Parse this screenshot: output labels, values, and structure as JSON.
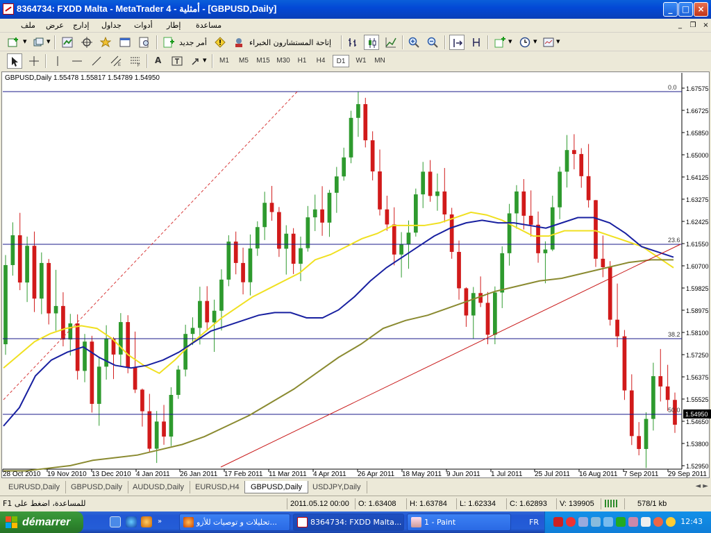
{
  "window": {
    "title": "8364734: FXDD Malta - MetaTrader 4 - أمثلية - [GBPUSD,Daily]",
    "controls": {
      "minimize": "_",
      "maximize": "□",
      "close": "×"
    }
  },
  "menu": {
    "items": [
      "ملف",
      "عرض",
      "إدارج",
      "جداول",
      "أدوات",
      "إطار",
      "مساعدة"
    ],
    "mdi": {
      "minimize": "_",
      "restore": "❐",
      "close": "×"
    }
  },
  "toolbar1": {
    "new_order": "أمر جديد",
    "experts": "إتاحة المستشارون الخبراء"
  },
  "toolbar2": {
    "periods": [
      "M1",
      "M5",
      "M15",
      "M30",
      "H1",
      "H4",
      "D1",
      "W1",
      "MN"
    ],
    "active_period": "D1",
    "text_tool": "A"
  },
  "chart": {
    "info": "GBPUSD,Daily  1.55478 1.55817 1.54789 1.54950"
  },
  "chart_data": {
    "type": "candlestick",
    "symbol": "GBPUSD",
    "timeframe": "Daily",
    "ohlc_last": {
      "open": 1.55478,
      "high": 1.55817,
      "low": 1.54789,
      "close": 1.5495
    },
    "current_price": "1.54950",
    "ylim": [
      1.5295,
      1.67575
    ],
    "y_ticks": [
      "1.67575",
      "1.66725",
      "1.65850",
      "1.65000",
      "1.64125",
      "1.63275",
      "1.62425",
      "1.61550",
      "1.60700",
      "1.59825",
      "1.58975",
      "1.58100",
      "1.57250",
      "1.56375",
      "1.55525",
      "1.54650",
      "1.53800",
      "1.52950"
    ],
    "x_ticks": [
      "28 Oct 2010",
      "19 Nov 2010",
      "13 Dec 2010",
      "4 Jan 2011",
      "26 Jan 2011",
      "17 Feb 2011",
      "11 Mar 2011",
      "4 Apr 2011",
      "26 Apr 2011",
      "18 May 2011",
      "9 Jun 2011",
      "1 Jul 2011",
      "25 Jul 2011",
      "16 Aug 2011",
      "7 Sep 2011",
      "29 Sep 2011"
    ],
    "fibonacci": [
      {
        "label": "0.0",
        "price": 1.67575
      },
      {
        "label": "23.6",
        "price": 1.6155
      },
      {
        "label": "38.2",
        "price": 1.5788
      },
      {
        "label": "50.0",
        "price": 1.5484
      }
    ],
    "moving_averages": [
      {
        "color": "#f0e020",
        "values": [
          1.571,
          1.576,
          1.581,
          1.584,
          1.586,
          1.587,
          1.586,
          1.582,
          1.576,
          1.572,
          1.569,
          1.574,
          1.58,
          1.585,
          1.59,
          1.594,
          1.598,
          1.601,
          1.604,
          1.607,
          1.612,
          1.614,
          1.617,
          1.62,
          1.622,
          1.625,
          1.625,
          1.625,
          1.626,
          1.628,
          1.63,
          1.629,
          1.627,
          1.624,
          1.621,
          1.621,
          1.623,
          1.623,
          1.623,
          1.621,
          1.619,
          1.617,
          1.613,
          1.609
        ]
      },
      {
        "color": "#1820a0",
        "values": [
          1.549,
          1.556,
          1.568,
          1.574,
          1.577,
          1.579,
          1.575,
          1.572,
          1.571,
          1.572,
          1.574,
          1.577,
          1.581,
          1.585,
          1.587,
          1.589,
          1.591,
          1.592,
          1.592,
          1.59,
          1.59,
          1.593,
          1.598,
          1.604,
          1.609,
          1.613,
          1.617,
          1.621,
          1.624,
          1.626,
          1.627,
          1.626,
          1.626,
          1.625,
          1.624,
          1.626,
          1.628,
          1.628,
          1.626,
          1.622,
          1.617,
          1.615,
          1.613
        ]
      },
      {
        "color": "#8a8a30",
        "values": [
          1.532,
          1.532,
          1.533,
          1.534,
          1.536,
          1.537,
          1.538,
          1.54,
          1.542,
          1.545,
          1.549,
          1.553,
          1.558,
          1.563,
          1.569,
          1.575,
          1.58,
          1.586,
          1.589,
          1.591,
          1.594,
          1.597,
          1.6,
          1.602,
          1.604,
          1.605,
          1.607,
          1.609,
          1.611,
          1.612,
          1.612
        ]
      }
    ],
    "trendlines": [
      {
        "style": "dashed",
        "color": "#d83a3a"
      },
      {
        "style": "solid",
        "color": "#c81818"
      }
    ],
    "candles": [
      [
        1.58,
        1.6138,
        1.576,
        1.61
      ],
      [
        1.61,
        1.6262,
        1.606,
        1.6213
      ],
      [
        1.6213,
        1.6298,
        1.6005,
        1.6034
      ],
      [
        1.6034,
        1.6208,
        1.596,
        1.6173
      ],
      [
        1.6173,
        1.6227,
        1.5922,
        1.5973
      ],
      [
        1.5973,
        1.6148,
        1.5914,
        1.6108
      ],
      [
        1.6108,
        1.6123,
        1.5875,
        1.5917
      ],
      [
        1.5917,
        1.6082,
        1.5851,
        1.5945
      ],
      [
        1.5945,
        1.5997,
        1.5792,
        1.5818
      ],
      [
        1.5818,
        1.5915,
        1.5757,
        1.5879
      ],
      [
        1.5879,
        1.5913,
        1.5666,
        1.5699
      ],
      [
        1.5699,
        1.5839,
        1.5656,
        1.581
      ],
      [
        1.581,
        1.5832,
        1.5541,
        1.5574
      ],
      [
        1.5574,
        1.5753,
        1.5491,
        1.5715
      ],
      [
        1.5715,
        1.5872,
        1.5666,
        1.5822
      ],
      [
        1.5822,
        1.5827,
        1.5668,
        1.5761
      ],
      [
        1.5761,
        1.5918,
        1.5716,
        1.5884
      ],
      [
        1.5884,
        1.591,
        1.569,
        1.5712
      ],
      [
        1.5712,
        1.5848,
        1.5615,
        1.5628
      ],
      [
        1.5628,
        1.5632,
        1.5488,
        1.5546
      ],
      [
        1.5546,
        1.5612,
        1.5392,
        1.5404
      ],
      [
        1.5404,
        1.5547,
        1.535,
        1.5507
      ],
      [
        1.5507,
        1.557,
        1.5419,
        1.545
      ],
      [
        1.545,
        1.5637,
        1.5414,
        1.5608
      ],
      [
        1.5608,
        1.5719,
        1.5593,
        1.5704
      ],
      [
        1.5704,
        1.5874,
        1.5678,
        1.5839
      ],
      [
        1.5839,
        1.5902,
        1.5797,
        1.5862
      ],
      [
        1.5862,
        1.6018,
        1.5799,
        1.5964
      ],
      [
        1.5964,
        1.602,
        1.5856,
        1.5883
      ],
      [
        1.5883,
        1.5969,
        1.5771,
        1.5927
      ],
      [
        1.5927,
        1.6084,
        1.5852,
        1.6045
      ],
      [
        1.6045,
        1.6213,
        1.602,
        1.6189
      ],
      [
        1.6189,
        1.6227,
        1.6065,
        1.6108
      ],
      [
        1.6108,
        1.6166,
        1.5989,
        1.6035
      ],
      [
        1.6035,
        1.6216,
        1.5985,
        1.6163
      ],
      [
        1.6163,
        1.6266,
        1.6135,
        1.6244
      ],
      [
        1.6244,
        1.6378,
        1.6195,
        1.6336
      ],
      [
        1.6336,
        1.64,
        1.6268,
        1.6301
      ],
      [
        1.6301,
        1.632,
        1.6131,
        1.6162
      ],
      [
        1.6162,
        1.6251,
        1.6064,
        1.6219
      ],
      [
        1.6219,
        1.624,
        1.6066,
        1.6105
      ],
      [
        1.6105,
        1.6208,
        1.6039,
        1.6164
      ],
      [
        1.6164,
        1.6324,
        1.6151,
        1.6281
      ],
      [
        1.6281,
        1.6367,
        1.6229,
        1.6311
      ],
      [
        1.6311,
        1.6399,
        1.6211,
        1.6261
      ],
      [
        1.6261,
        1.6385,
        1.6207,
        1.6374
      ],
      [
        1.6374,
        1.6472,
        1.6298,
        1.6436
      ],
      [
        1.6436,
        1.6545,
        1.642,
        1.6508
      ],
      [
        1.6508,
        1.6685,
        1.6486,
        1.6658
      ],
      [
        1.6658,
        1.6758,
        1.6586,
        1.671
      ],
      [
        1.671,
        1.6734,
        1.6546,
        1.6573
      ],
      [
        1.6573,
        1.6607,
        1.6421,
        1.6455
      ],
      [
        1.6455,
        1.6538,
        1.6288,
        1.6311
      ],
      [
        1.6311,
        1.6363,
        1.623,
        1.6254
      ],
      [
        1.6254,
        1.6319,
        1.6099,
        1.614
      ],
      [
        1.614,
        1.6225,
        1.6053,
        1.6178
      ],
      [
        1.6178,
        1.6269,
        1.6086,
        1.6223
      ],
      [
        1.6223,
        1.639,
        1.6208,
        1.6368
      ],
      [
        1.6368,
        1.6491,
        1.6316,
        1.6454
      ],
      [
        1.6454,
        1.6498,
        1.634,
        1.6362
      ],
      [
        1.6362,
        1.6447,
        1.6306,
        1.6379
      ],
      [
        1.6379,
        1.6468,
        1.6262,
        1.6292
      ],
      [
        1.6292,
        1.6317,
        1.6124,
        1.615
      ],
      [
        1.615,
        1.6193,
        1.5969,
        1.6012
      ],
      [
        1.6012,
        1.6016,
        1.5866,
        1.5909
      ],
      [
        1.5909,
        1.6017,
        1.5821,
        1.5994
      ],
      [
        1.5994,
        1.6057,
        1.5941,
        1.5957
      ],
      [
        1.5957,
        1.5998,
        1.58,
        1.5836
      ],
      [
        1.5836,
        1.6019,
        1.58,
        1.5996
      ],
      [
        1.5996,
        1.6171,
        1.5937,
        1.6145
      ],
      [
        1.6145,
        1.6332,
        1.6098,
        1.6296
      ],
      [
        1.6296,
        1.6403,
        1.6238,
        1.6379
      ],
      [
        1.6379,
        1.6426,
        1.6235,
        1.6287
      ],
      [
        1.6287,
        1.6383,
        1.6208,
        1.6253
      ],
      [
        1.6253,
        1.6303,
        1.6109,
        1.6145
      ],
      [
        1.6145,
        1.619,
        1.6031,
        1.6159
      ],
      [
        1.6159,
        1.6363,
        1.6153,
        1.6319
      ],
      [
        1.6319,
        1.6473,
        1.6274,
        1.6454
      ],
      [
        1.6454,
        1.6593,
        1.6394,
        1.6536
      ],
      [
        1.6536,
        1.6596,
        1.6463,
        1.6521
      ],
      [
        1.6521,
        1.6543,
        1.6393,
        1.6437
      ],
      [
        1.6437,
        1.6559,
        1.6318,
        1.6346
      ],
      [
        1.6346,
        1.6347,
        1.6093,
        1.6124
      ],
      [
        1.6124,
        1.6212,
        1.6054,
        1.6092
      ],
      [
        1.6092,
        1.6115,
        1.5871,
        1.5893
      ],
      [
        1.5893,
        1.603,
        1.5789,
        1.583
      ],
      [
        1.583,
        1.5854,
        1.5589,
        1.5625
      ],
      [
        1.5625,
        1.5686,
        1.5418,
        1.5452
      ],
      [
        1.5452,
        1.5505,
        1.5379,
        1.5403
      ],
      [
        1.5403,
        1.5542,
        1.5331,
        1.5517
      ],
      [
        1.5517,
        1.573,
        1.5473,
        1.5679
      ],
      [
        1.5679,
        1.5782,
        1.5583,
        1.564
      ],
      [
        1.564,
        1.5722,
        1.5547,
        1.5589
      ],
      [
        1.5589,
        1.5617,
        1.5464,
        1.5495
      ]
    ]
  },
  "tabs": {
    "items": [
      "EURUSD,Daily",
      "GBPUSD,Daily",
      "AUDUSD,Daily",
      "EURUSD,H4",
      "GBPUSD,Daily",
      "USDJPY,Daily"
    ],
    "active_index": 4,
    "arrows": "◄ ►"
  },
  "status": {
    "help": "للمساعدة، اضغط على F1",
    "datetime": "2011.05.12 00:00",
    "open": "O: 1.63408",
    "high": "H: 1.63784",
    "low": "L: 1.62334",
    "close": "C: 1.62893",
    "volume": "V: 139905",
    "traffic": "578/1 kb"
  },
  "taskbar": {
    "start": "démarrer",
    "tasks": [
      {
        "label": "تحليلات و توصيات للأزو...",
        "active": false
      },
      {
        "label": "8364734: FXDD Malta...",
        "active": true
      },
      {
        "label": "1 - Paint",
        "active": false
      }
    ],
    "lang": "FR",
    "clock": "12:43"
  }
}
